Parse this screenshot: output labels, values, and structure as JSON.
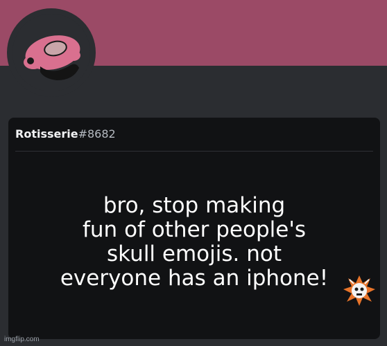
{
  "profile": {
    "username": "Rotisserie",
    "discriminator": "#8682",
    "banner_color": "#9b4a66",
    "avatar_icon": "pink-cap-character-avatar"
  },
  "message": {
    "lines": [
      "bro, stop making",
      "fun of other people's",
      "skull emojis. not",
      "everyone has an iphone!"
    ],
    "emoji_icon": "skull-explosion-emoji"
  },
  "watermark": "imgflip.com"
}
